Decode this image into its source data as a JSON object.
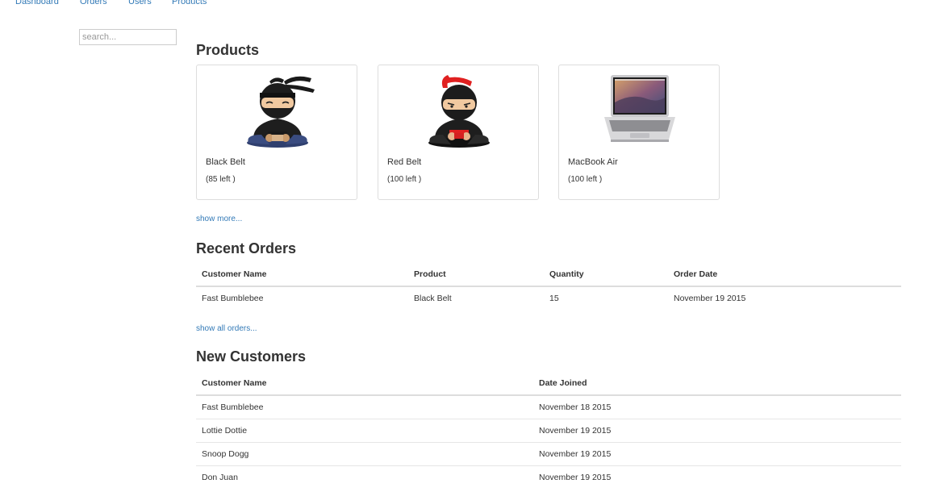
{
  "nav": {
    "items": [
      {
        "label": "Dashboard"
      },
      {
        "label": "Orders"
      },
      {
        "label": "Users"
      },
      {
        "label": "Products"
      }
    ]
  },
  "search": {
    "placeholder": "search...",
    "value": ""
  },
  "products": {
    "title": "Products",
    "items": [
      {
        "name": "Black Belt",
        "stock": "(85 left )",
        "icon": "black-belt-ninja-icon"
      },
      {
        "name": "Red Belt",
        "stock": "(100 left )",
        "icon": "red-belt-ninja-icon"
      },
      {
        "name": "MacBook Air",
        "stock": "(100 left )",
        "icon": "macbook-air-icon"
      }
    ],
    "more_link": "show more..."
  },
  "recent_orders": {
    "title": "Recent Orders",
    "columns": [
      "Customer Name",
      "Product",
      "Quantity",
      "Order Date"
    ],
    "rows": [
      [
        "Fast Bumblebee",
        "Black Belt",
        "15",
        "November 19 2015"
      ]
    ],
    "more_link": "show all orders..."
  },
  "new_customers": {
    "title": "New Customers",
    "columns": [
      "Customer Name",
      "Date Joined"
    ],
    "rows": [
      [
        "Fast Bumblebee",
        "November 18 2015"
      ],
      [
        "Lottie Dottie",
        "November 19 2015"
      ],
      [
        "Snoop Dogg",
        "November 19 2015"
      ],
      [
        "Don Juan",
        "November 19 2015"
      ]
    ]
  },
  "colors": {
    "link": "#337ab7",
    "text": "#333333",
    "border": "#dddddd",
    "red_belt": "#e02020"
  }
}
